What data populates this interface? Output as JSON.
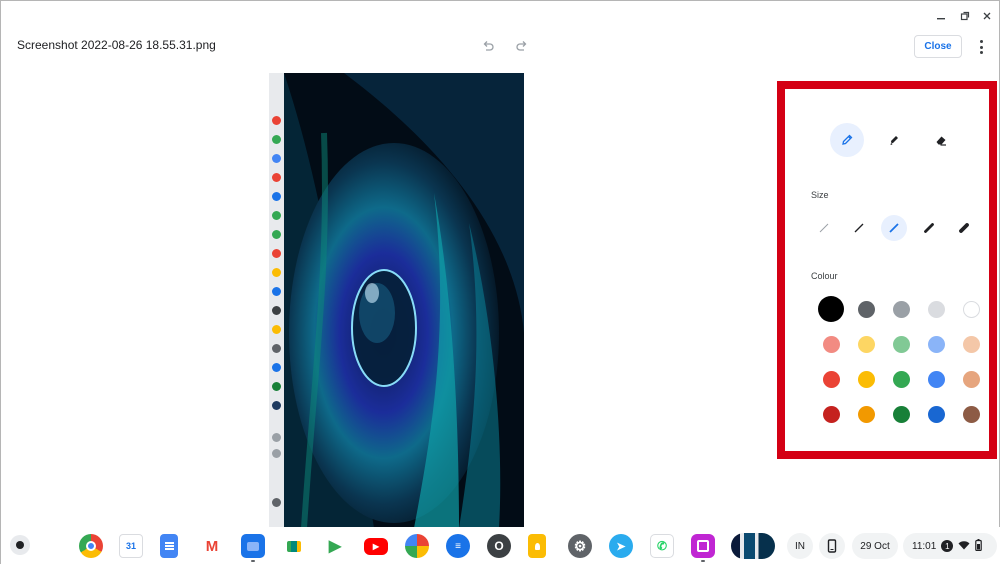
{
  "window": {
    "minimize_icon": "minimize-icon",
    "maximize_icon": "restore-icon",
    "close_icon": "close-icon"
  },
  "header": {
    "file_title": "Screenshot 2022-08-26 18.55.31.png",
    "close_label": "Close",
    "undo_icon": "undo-icon",
    "redo_icon": "redo-icon",
    "more_icon": "more-vert-icon"
  },
  "annotation_panel": {
    "tools": [
      {
        "name": "pen",
        "icon": "pen-icon",
        "active": true
      },
      {
        "name": "highlighter",
        "icon": "highlighter-icon",
        "active": false
      },
      {
        "name": "eraser",
        "icon": "eraser-icon",
        "active": false
      }
    ],
    "size_label": "Size",
    "sizes": [
      {
        "name": "extra-thin",
        "active": false
      },
      {
        "name": "thin",
        "active": false
      },
      {
        "name": "medium",
        "active": true
      },
      {
        "name": "thick",
        "active": false
      },
      {
        "name": "extra-thick",
        "active": false
      }
    ],
    "colour_label": "Colour",
    "colours": [
      [
        "#000000",
        "#5f6368",
        "#9aa0a6",
        "#dadce0",
        "#ffffff"
      ],
      [
        "#f28b82",
        "#fdd663",
        "#81c995",
        "#8ab4f8",
        "#f4c7a8"
      ],
      [
        "#ea4335",
        "#fbbc04",
        "#34a853",
        "#4285f4",
        "#e6a57e"
      ],
      [
        "#c5221f",
        "#f29900",
        "#188038",
        "#1967d2",
        "#8d5b45"
      ]
    ],
    "selected_colour": "#000000",
    "highlight_color": "#d40014"
  },
  "shelf": {
    "apps": [
      {
        "name": "chrome",
        "icon": "chrome-icon",
        "glyph": ""
      },
      {
        "name": "calendar",
        "icon": "calendar-icon",
        "glyph": "31"
      },
      {
        "name": "docs",
        "icon": "docs-icon",
        "glyph": ""
      },
      {
        "name": "gmail",
        "icon": "gmail-icon",
        "glyph": "M"
      },
      {
        "name": "files",
        "icon": "files-icon",
        "glyph": ""
      },
      {
        "name": "meet",
        "icon": "meet-icon",
        "glyph": ""
      },
      {
        "name": "play-store",
        "icon": "play-store-icon",
        "glyph": "▶"
      },
      {
        "name": "youtube",
        "icon": "youtube-icon",
        "glyph": "▶"
      },
      {
        "name": "photos",
        "icon": "photos-icon",
        "glyph": ""
      },
      {
        "name": "messages",
        "icon": "messages-icon",
        "glyph": "≡"
      },
      {
        "name": "o-app",
        "icon": "o-app-icon",
        "glyph": "O"
      },
      {
        "name": "keep",
        "icon": "keep-icon",
        "glyph": ""
      },
      {
        "name": "settings",
        "icon": "settings-icon",
        "glyph": "⚙"
      },
      {
        "name": "telegram",
        "icon": "telegram-icon",
        "glyph": "➤"
      },
      {
        "name": "whatsapp",
        "icon": "whatsapp-icon",
        "glyph": "✆"
      },
      {
        "name": "screenshot-app",
        "icon": "screenshot-app-icon",
        "glyph": ""
      }
    ],
    "ime_label": "IN",
    "date_label": "29 Oct",
    "time_label": "11:01",
    "notification_count": "1"
  }
}
